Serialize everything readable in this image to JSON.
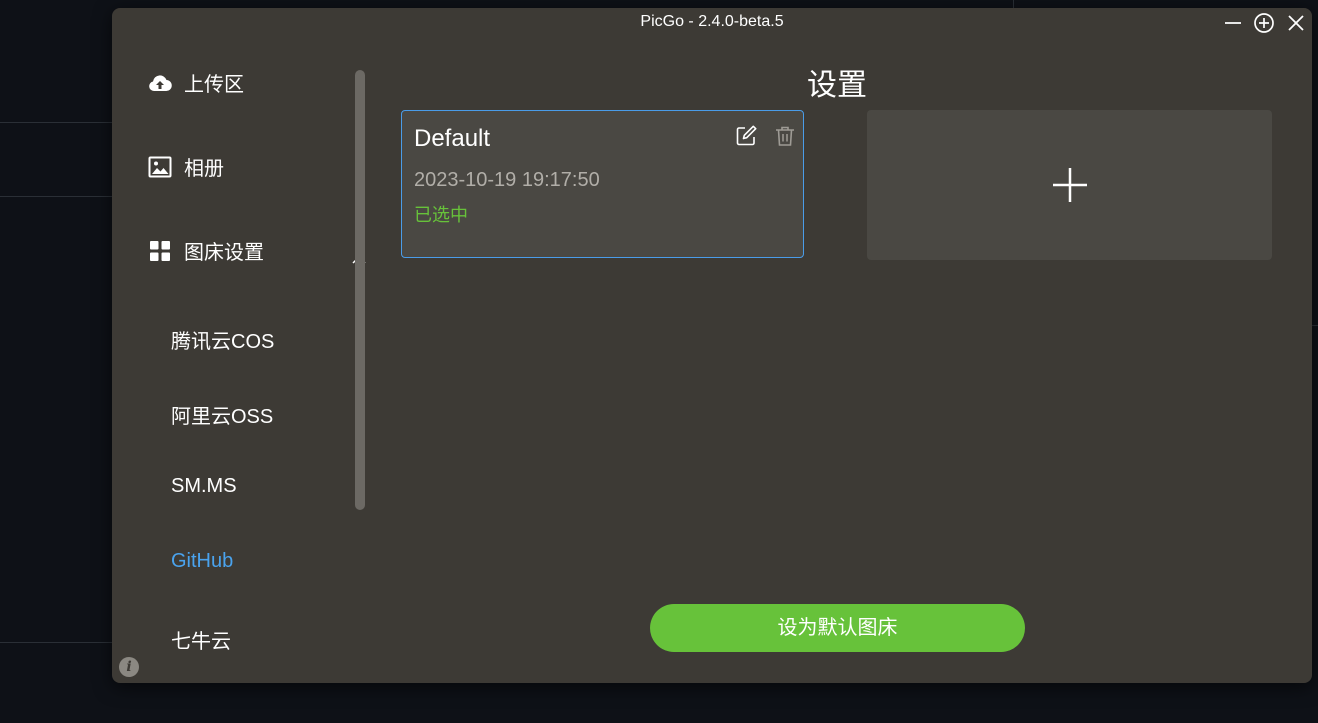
{
  "window": {
    "title": "PicGo - 2.4.0-beta.5"
  },
  "controls": {
    "minimize_icon": "minus-icon",
    "always_on_top_icon": "circle-plus-icon",
    "close_icon": "close-icon"
  },
  "sidebar": {
    "items": [
      {
        "label": "上传区",
        "icon": "cloud-upload-icon"
      },
      {
        "label": "相册",
        "icon": "picture-icon"
      },
      {
        "label": "图床设置",
        "icon": "grid-icon",
        "expanded": true
      }
    ],
    "sub_items": [
      {
        "label": "腾讯云COS",
        "active": false
      },
      {
        "label": "阿里云OSS",
        "active": false
      },
      {
        "label": "SM.MS",
        "active": false
      },
      {
        "label": "GitHub",
        "active": true
      },
      {
        "label": "七牛云",
        "active": false
      }
    ],
    "info_icon_glyph": "i"
  },
  "main": {
    "title": "设置",
    "config": {
      "name": "Default",
      "date": "2023-10-19 19:17:50",
      "status": "已选中"
    },
    "default_button_label": "设为默认图床"
  },
  "colors": {
    "window_bg": "#3d3a35",
    "card_bg": "#4a4843",
    "accent_blue": "#4a9ce8",
    "active_nav": "#4aa3ee",
    "success_green": "#67c23a"
  }
}
